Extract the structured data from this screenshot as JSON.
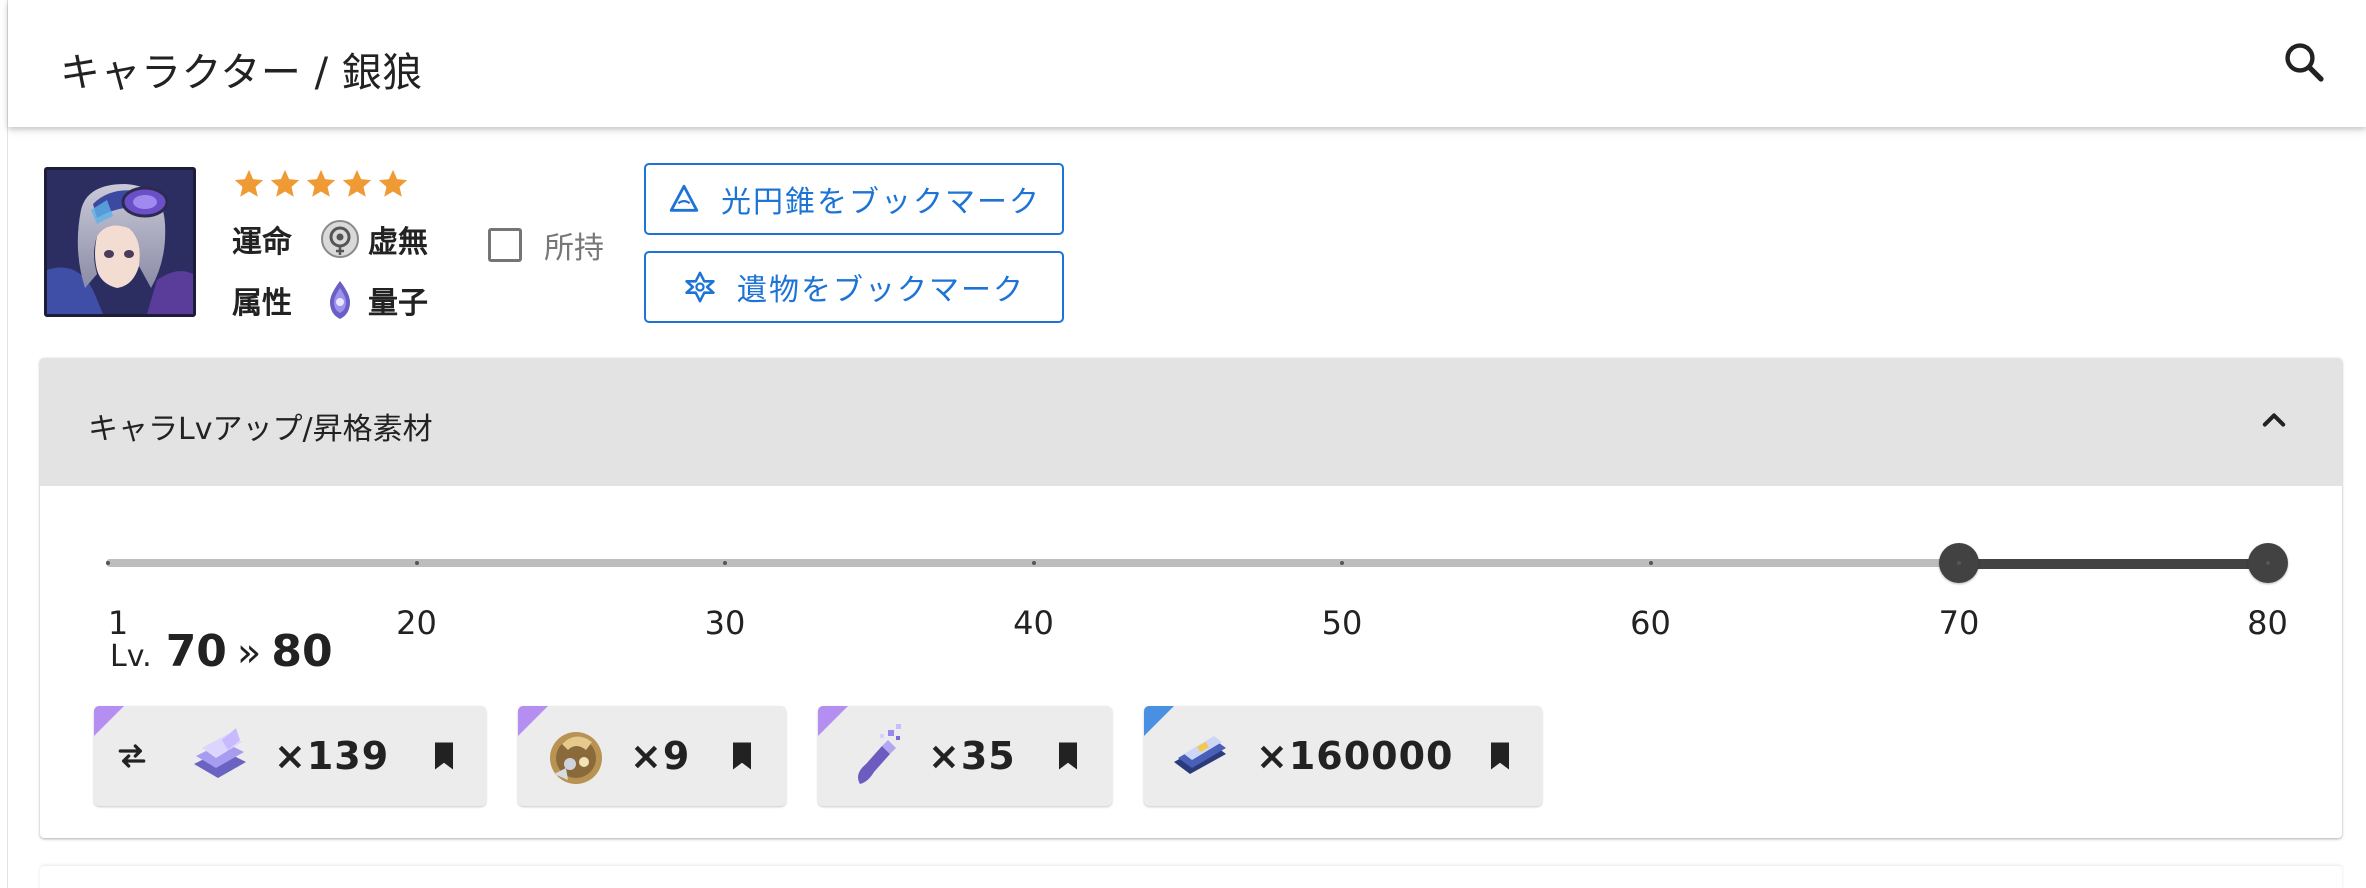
{
  "appbar": {
    "title": "キャラクター / 銀狼",
    "search_icon": "search-icon"
  },
  "character": {
    "rarity_stars": 5,
    "star_color": "#f09a35",
    "path_key": "運命",
    "path_value": "虚無",
    "element_key": "属性",
    "element_value": "量子",
    "owned_label": "所持",
    "owned_checked": false,
    "lightcone_bookmark_label": "光円錐をブックマーク",
    "relic_bookmark_label": "遺物をブックマーク"
  },
  "ascension_panel": {
    "title": "キャラLvアップ/昇格素材",
    "expanded": true,
    "slider": {
      "ticks": [
        "1",
        "20",
        "30",
        "40",
        "50",
        "60",
        "70",
        "80"
      ],
      "from": 70,
      "to": 80
    },
    "level_prefix": "Lv.",
    "level_from": "70",
    "level_arrow": "»",
    "level_to": "80",
    "materials": [
      {
        "name": "exp-material",
        "quantity": "×139",
        "rarity_color": "#b48ef0",
        "swap": true
      },
      {
        "name": "ascension-material",
        "quantity": "×9",
        "rarity_color": "#b48ef0",
        "swap": false
      },
      {
        "name": "trace-material",
        "quantity": "×35",
        "rarity_color": "#b48ef0",
        "swap": false
      },
      {
        "name": "credit",
        "quantity": "×160000",
        "rarity_color": "#4a90e2",
        "swap": false
      }
    ]
  }
}
